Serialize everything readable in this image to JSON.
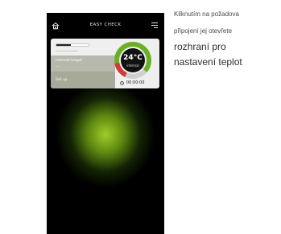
{
  "app": {
    "title": "EASY CHECK",
    "icons": {
      "home": "home-icon",
      "menu": "hamburger-menu-icon",
      "clock": "clock-icon"
    }
  },
  "card": {
    "battery_level": 0.45,
    "target_label": "Internal target",
    "target_value": "---",
    "setup_label": "Set up",
    "temperature": "24°C",
    "temperature_sub": "internal",
    "timer": "00:00:00",
    "gauge_colors": {
      "green": "#6ab023",
      "red": "#d23a3a",
      "track": "#cfcfcf",
      "center": "#111111"
    }
  },
  "caption": {
    "line1": "Kliknutím na požadova",
    "line2": "připojení jej otevřete",
    "line3": "rozhraní pro",
    "line4": "nastavení teplot"
  }
}
